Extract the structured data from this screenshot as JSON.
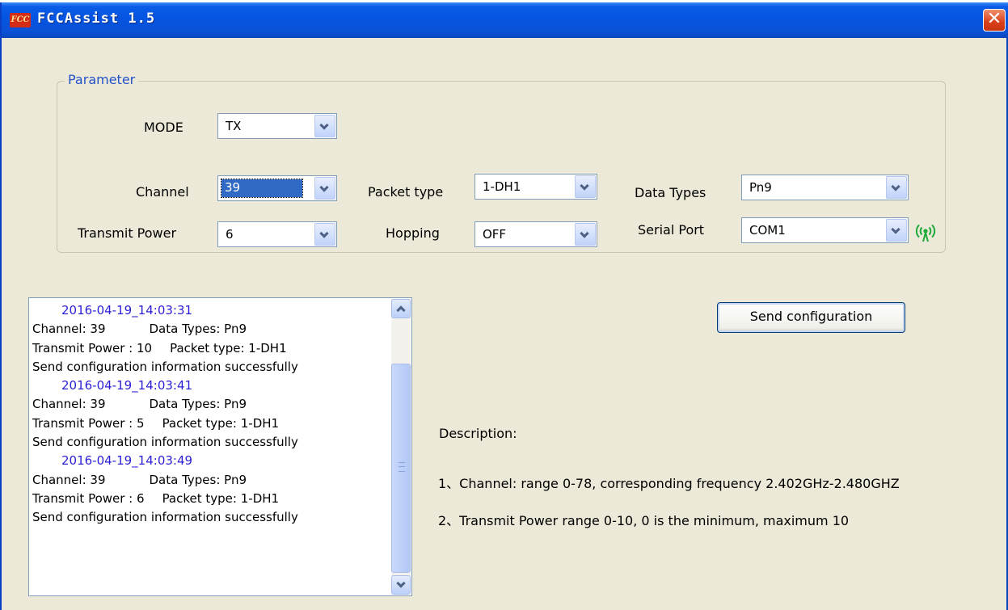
{
  "window": {
    "title": "FCCAssist 1.5",
    "app_icon_text": "FCC",
    "close_glyph": "✕",
    "icons": {
      "app": "fcc-app-icon",
      "close": "close-icon",
      "status": "signal-icon"
    },
    "colors": {
      "titlebar": "#0554e1",
      "window_bg": "#ece9d8",
      "legend": "#2452c8",
      "timestamp": "#2b1fd6",
      "selection": "#316ac5",
      "status_icon": "#1faa3a"
    }
  },
  "parameter": {
    "legend": "Parameter",
    "mode": {
      "label": "MODE",
      "value": "TX"
    },
    "channel": {
      "label": "Channel",
      "value": "39"
    },
    "packet_type": {
      "label": "Packet type",
      "value": "1-DH1"
    },
    "data_types": {
      "label": "Data Types",
      "value": "Pn9"
    },
    "transmit_power": {
      "label": "Transmit Power",
      "value": "6"
    },
    "hopping": {
      "label": "Hopping",
      "value": "OFF"
    },
    "serial_port": {
      "label": "Serial Port",
      "value": "COM1"
    }
  },
  "log": {
    "entries": [
      {
        "timestamp": "2016-04-19_14:03:31",
        "channel": "Channel: 39",
        "data_types": "Data Types: Pn9",
        "power": "Transmit Power : 10",
        "packet": "Packet type: 1-DH1",
        "result": "Send configuration information successfully"
      },
      {
        "timestamp": "2016-04-19_14:03:41",
        "channel": "Channel: 39",
        "data_types": "Data Types: Pn9",
        "power": "Transmit Power : 5",
        "packet": "Packet type: 1-DH1",
        "result": "Send configuration information successfully"
      },
      {
        "timestamp": "2016-04-19_14:03:49",
        "channel": "Channel: 39",
        "data_types": "Data Types: Pn9",
        "power": "Transmit Power : 6",
        "packet": "Packet type: 1-DH1",
        "result": "Send configuration information successfully"
      }
    ]
  },
  "actions": {
    "send_label": "Send configuration"
  },
  "description": {
    "title": "Description:",
    "lines": [
      "1、Channel: range 0-78, corresponding frequency 2.402GHz-2.480GHZ",
      "2、Transmit Power  range 0-10, 0 is the minimum, maximum 10"
    ]
  }
}
